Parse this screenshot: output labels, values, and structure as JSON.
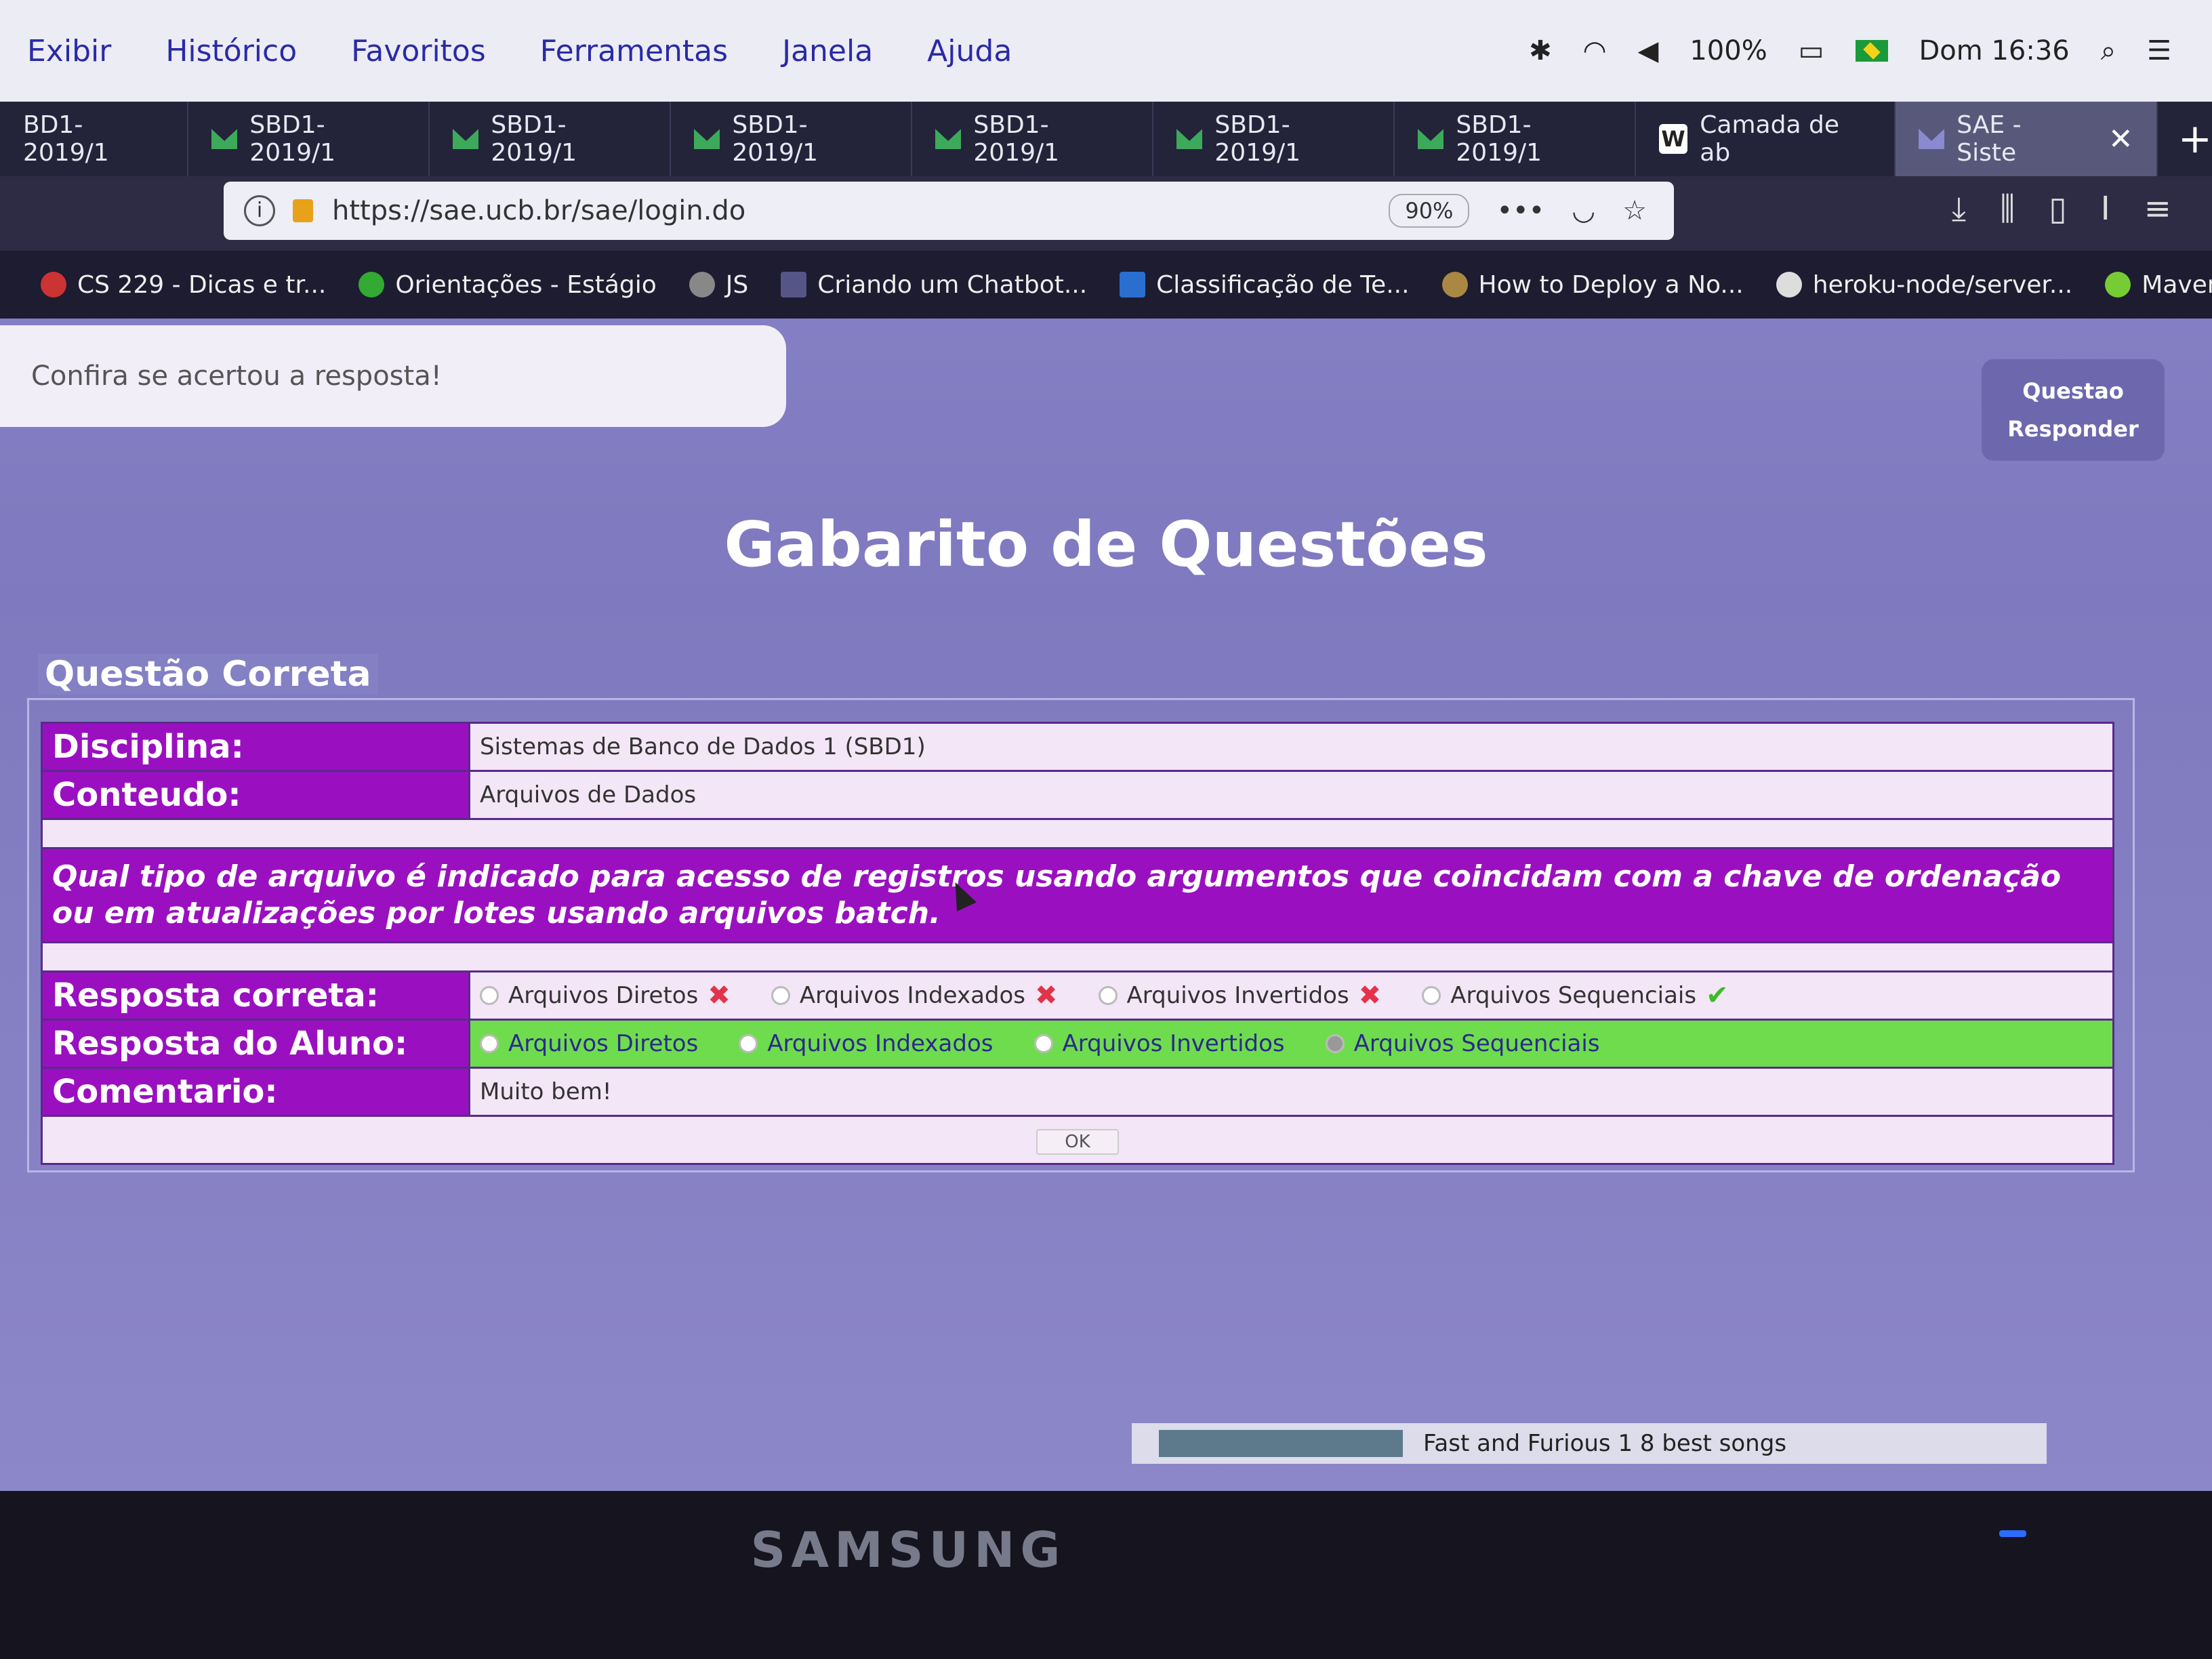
{
  "menubar": {
    "items": [
      "Exibir",
      "Histórico",
      "Favoritos",
      "Ferramentas",
      "Janela",
      "Ajuda"
    ],
    "battery": "100%",
    "clock": "Dom 16:36"
  },
  "tabs": [
    {
      "label": "BD1-2019/1"
    },
    {
      "label": "SBD1-2019/1"
    },
    {
      "label": "SBD1-2019/1"
    },
    {
      "label": "SBD1-2019/1"
    },
    {
      "label": "SBD1-2019/1"
    },
    {
      "label": "SBD1-2019/1"
    },
    {
      "label": "SBD1-2019/1"
    },
    {
      "label": "Camada de ab"
    },
    {
      "label": "SAE - Siste"
    }
  ],
  "urlbar": {
    "url": "https://sae.ucb.br/sae/login.do",
    "zoom": "90%"
  },
  "bookmarks": [
    "CS 229 - Dicas e tr...",
    "Orientações - Estágio",
    "JS",
    "Criando um Chatbot...",
    "Classificação de Te...",
    "How to Deploy a No...",
    "heroku-node/server...",
    "Maven Tutorial: Intr..."
  ],
  "page": {
    "notice": "Confira se acertou a resposta!",
    "actions": {
      "questao": "Questao",
      "responder": "Responder"
    },
    "title": "Gabarito de Questões",
    "legend": "Questão Correta",
    "disciplina_label": "Disciplina:",
    "disciplina": "Sistemas de Banco de Dados 1 (SBD1)",
    "conteudo_label": "Conteudo:",
    "conteudo": "Arquivos de Dados",
    "question": "Qual tipo de arquivo é indicado para acesso de registros usando argumentos que coincidam com a chave de ordenação ou em atualizações por lotes usando arquivos batch.",
    "resposta_correta_label": "Resposta correta:",
    "resposta_aluno_label": "Resposta do Aluno:",
    "comentario_label": "Comentario:",
    "comentario": "Muito bem!",
    "ok": "OK",
    "options": [
      "Arquivos Diretos",
      "Arquivos Indexados",
      "Arquivos Invertidos",
      "Arquivos Sequenciais"
    ],
    "correct_option": "Arquivos Sequenciais"
  },
  "taskbar": {
    "label": "Fast and Furious 1 8 best songs"
  },
  "monitor": {
    "brand": "SAMSUNG"
  }
}
